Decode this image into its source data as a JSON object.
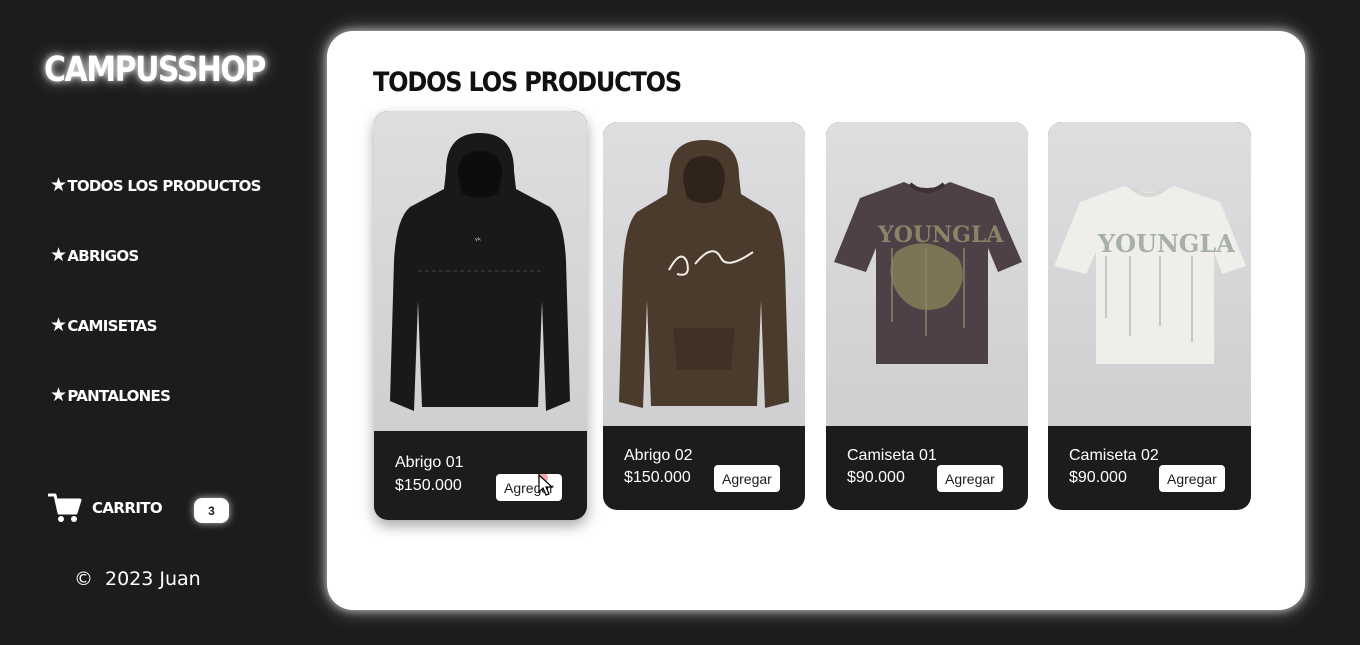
{
  "sidebar": {
    "logo": "CAMPUSSHOP",
    "nav": [
      {
        "label": "TODOS LOS PRODUCTOS",
        "icon": "star-icon"
      },
      {
        "label": "ABRIGOS",
        "icon": "star-icon"
      },
      {
        "label": "CAMISETAS",
        "icon": "star-icon"
      },
      {
        "label": "PANTALONES",
        "icon": "star-icon"
      }
    ],
    "cart": {
      "label": "CARRITO",
      "count": "3",
      "icon": "cart-icon"
    },
    "footer": {
      "symbol": "©",
      "text": "2023 Juan"
    }
  },
  "main": {
    "title": "TODOS LOS PRODUCTOS",
    "products": [
      {
        "name": "Abrigo 01",
        "price": "$150.000",
        "button": "Agregar",
        "image": "black-hoodie"
      },
      {
        "name": "Abrigo 02",
        "price": "$150.000",
        "button": "Agregar",
        "image": "brown-hoodie"
      },
      {
        "name": "Camiseta 01",
        "price": "$90.000",
        "button": "Agregar",
        "image": "purple-tshirt"
      },
      {
        "name": "Camiseta 02",
        "price": "$90.000",
        "button": "Agregar",
        "image": "white-tshirt"
      }
    ]
  },
  "colors": {
    "background": "#1d1c1b",
    "panel": "#ffffff",
    "card_info": "#1d1c1b"
  }
}
